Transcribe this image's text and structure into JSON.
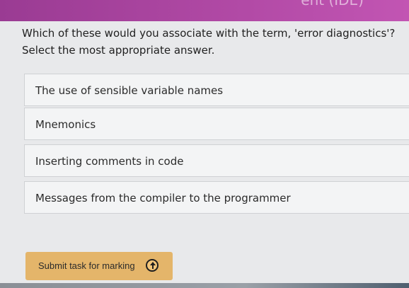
{
  "header": {
    "partial_title": "ent (IDE)"
  },
  "question": {
    "text": "Which of these would you associate with the term, 'error diagnostics'?",
    "instruction": "Select the most appropriate answer."
  },
  "answers": [
    {
      "label": "The use of sensible variable names"
    },
    {
      "label": "Mnemonics"
    },
    {
      "label": "Inserting comments in code"
    },
    {
      "label": "Messages from the compiler to the programmer"
    }
  ],
  "submit": {
    "label": "Submit task for marking",
    "icon": "upload-icon"
  }
}
